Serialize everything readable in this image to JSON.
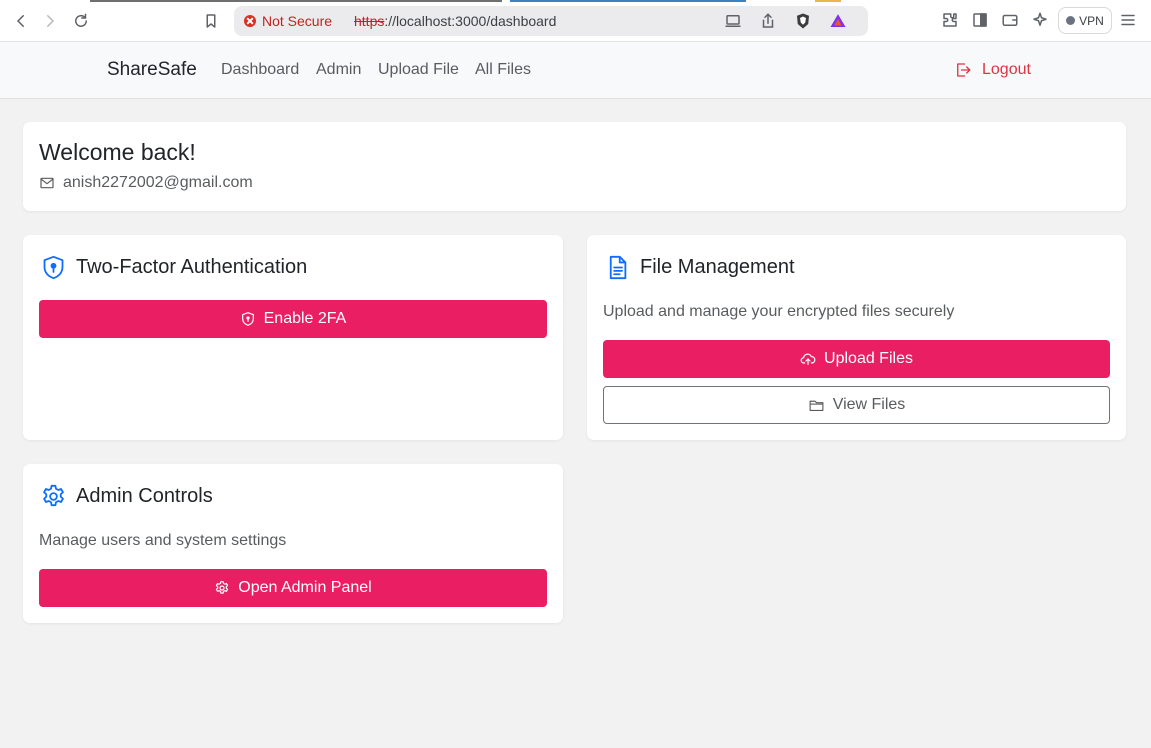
{
  "browser": {
    "security_label": "Not Secure",
    "url_scheme": "https",
    "url_rest": "://localhost:3000/dashboard",
    "vpn_label": "VPN"
  },
  "navbar": {
    "brand": "ShareSafe",
    "links": [
      "Dashboard",
      "Admin",
      "Upload File",
      "All Files"
    ],
    "logout_label": "Logout"
  },
  "welcome": {
    "title": "Welcome back!",
    "email": "anish2272002@gmail.com"
  },
  "two_factor": {
    "title": "Two-Factor Authentication",
    "button_label": "Enable 2FA"
  },
  "file_management": {
    "title": "File Management",
    "description": "Upload and manage your encrypted files securely",
    "upload_label": "Upload Files",
    "view_label": "View Files"
  },
  "admin_controls": {
    "title": "Admin Controls",
    "description": "Manage users and system settings",
    "button_label": "Open Admin Panel"
  },
  "icons": {
    "browser": [
      "back-icon",
      "forward-icon",
      "reload-icon",
      "bookmark-icon",
      "cast-icon",
      "share-icon",
      "brave-shield-icon",
      "brave-rewards-icon",
      "extensions-icon",
      "sidebar-icon",
      "wallet-icon",
      "leo-ai-icon",
      "menu-icon"
    ],
    "app": [
      "logout-icon",
      "envelope-icon",
      "shield-lock-icon",
      "file-text-icon",
      "gear-icon",
      "cloud-upload-icon",
      "folder-icon"
    ]
  },
  "colors": {
    "accent": "#e91e63",
    "icon_blue": "#0d6efd",
    "danger": "#dc3545",
    "page_bg": "#f2f2f2"
  }
}
